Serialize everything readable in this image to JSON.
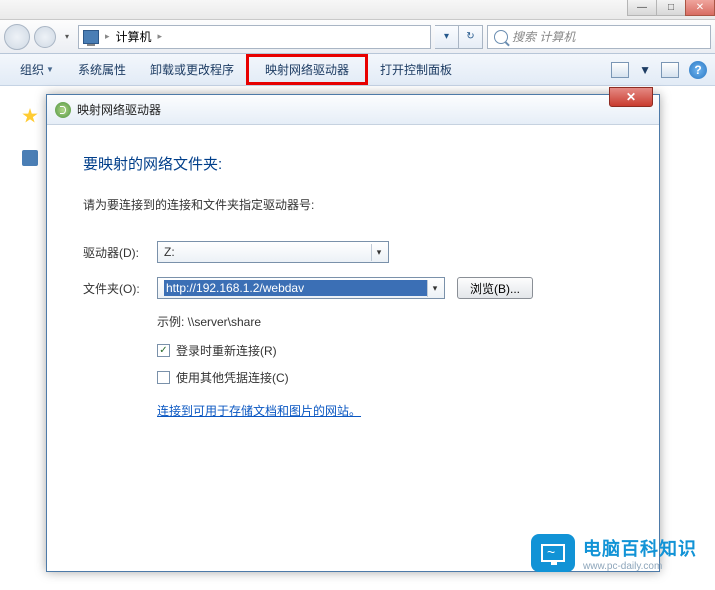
{
  "window": {
    "min": "—",
    "max": "□",
    "close": "✕"
  },
  "address": {
    "location": "计算机",
    "sep": "▸",
    "dropdown": "▾",
    "refresh": "↻",
    "search_placeholder": "搜索 计算机"
  },
  "toolbar": {
    "organize": "组织",
    "sys_props": "系统属性",
    "uninstall": "卸载或更改程序",
    "map_drive": "映射网络驱动器",
    "control_panel": "打开控制面板",
    "help": "?"
  },
  "dialog": {
    "title": "映射网络驱动器",
    "close": "✕",
    "heading": "要映射的网络文件夹:",
    "subtitle": "请为要连接到的连接和文件夹指定驱动器号:",
    "drive_label": "驱动器(D):",
    "drive_value": "Z:",
    "folder_label": "文件夹(O):",
    "folder_value": "http://192.168.1.2/webdav",
    "browse": "浏览(B)...",
    "example": "示例: \\\\server\\share",
    "reconnect": "登录时重新连接(R)",
    "other_creds": "使用其他凭据连接(C)",
    "link": "连接到可用于存储文档和图片的网站。",
    "checkmark": "✓",
    "arrow": "▾"
  },
  "watermark": {
    "title": "电脑百科知识",
    "url": "www.pc-daily.com"
  }
}
